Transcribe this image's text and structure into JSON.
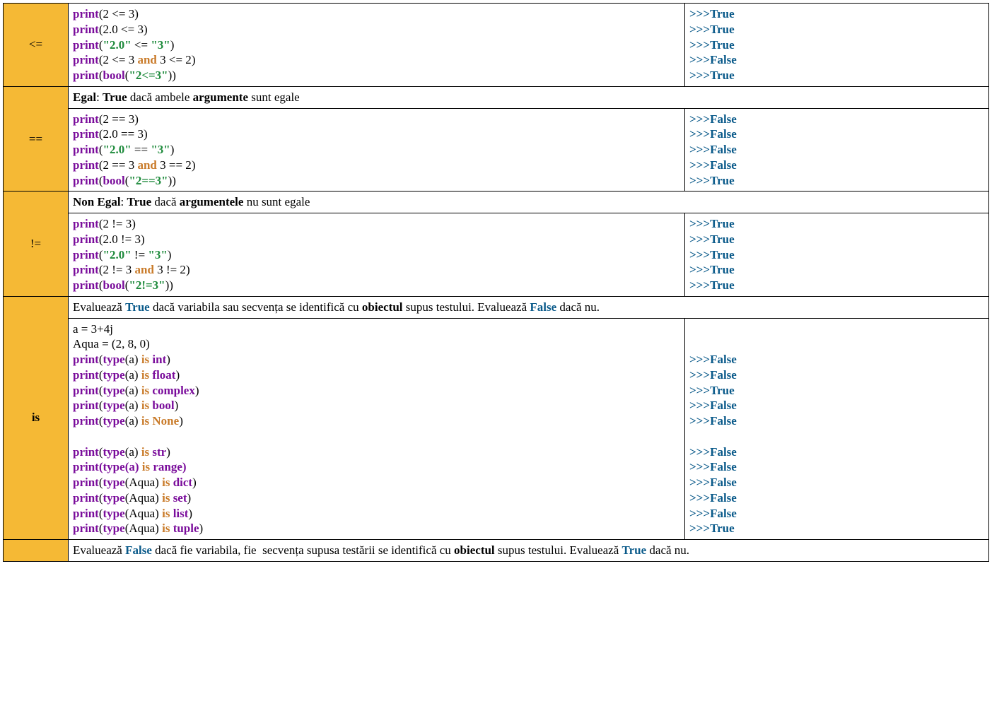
{
  "rows": [
    {
      "op": "<=",
      "opBold": false,
      "desc": null,
      "code": [
        [
          {
            "t": "print",
            "c": "kw"
          },
          {
            "t": "(",
            "c": "ptxt"
          },
          {
            "t": "2 <= 3",
            "c": "ptxt"
          },
          {
            "t": ")",
            "c": "ptxt"
          }
        ],
        [
          {
            "t": "print",
            "c": "kw"
          },
          {
            "t": "(",
            "c": "ptxt"
          },
          {
            "t": "2.0 <= 3",
            "c": "ptxt"
          },
          {
            "t": ")",
            "c": "ptxt"
          }
        ],
        [
          {
            "t": "print",
            "c": "kw"
          },
          {
            "t": "(",
            "c": "ptxt"
          },
          {
            "t": "\"2.0\"",
            "c": "str"
          },
          {
            "t": " <= ",
            "c": "ptxt"
          },
          {
            "t": "\"3\"",
            "c": "str"
          },
          {
            "t": ")",
            "c": "ptxt"
          }
        ],
        [
          {
            "t": "print",
            "c": "kw"
          },
          {
            "t": "(",
            "c": "ptxt"
          },
          {
            "t": "2 <= 3 ",
            "c": "ptxt"
          },
          {
            "t": "and",
            "c": "op2"
          },
          {
            "t": " 3 <= 2",
            "c": "ptxt"
          },
          {
            "t": ")",
            "c": "ptxt"
          }
        ],
        [
          {
            "t": "print",
            "c": "kw"
          },
          {
            "t": "(",
            "c": "ptxt"
          },
          {
            "t": "bool",
            "c": "kw"
          },
          {
            "t": "(",
            "c": "ptxt"
          },
          {
            "t": "\"2<=3\"",
            "c": "str"
          },
          {
            "t": "))",
            "c": "ptxt"
          }
        ]
      ],
      "output": [
        [
          {
            "t": ">>>",
            "c": "pr"
          },
          {
            "t": "True",
            "c": "tr"
          }
        ],
        [
          {
            "t": ">>>",
            "c": "pr"
          },
          {
            "t": "True",
            "c": "tr"
          }
        ],
        [
          {
            "t": ">>>",
            "c": "pr"
          },
          {
            "t": "True",
            "c": "tr"
          }
        ],
        [
          {
            "t": ">>>",
            "c": "pr"
          },
          {
            "t": "False",
            "c": "tr"
          }
        ],
        [
          {
            "t": ">>>",
            "c": "pr"
          },
          {
            "t": "True",
            "c": "tr"
          }
        ]
      ]
    },
    {
      "op": "==",
      "opBold": false,
      "desc": [
        {
          "t": "Egal",
          "c": "b"
        },
        {
          "t": ": ",
          "c": ""
        },
        {
          "t": "True",
          "c": "b"
        },
        {
          "t": " dacă ambele ",
          "c": ""
        },
        {
          "t": "argumente",
          "c": "b"
        },
        {
          "t": " sunt egale",
          "c": ""
        }
      ],
      "code": [
        [
          {
            "t": "print",
            "c": "kw"
          },
          {
            "t": "(",
            "c": "ptxt"
          },
          {
            "t": "2 == 3",
            "c": "ptxt"
          },
          {
            "t": ")",
            "c": "ptxt"
          }
        ],
        [
          {
            "t": "print",
            "c": "kw"
          },
          {
            "t": "(",
            "c": "ptxt"
          },
          {
            "t": "2.0 == 3",
            "c": "ptxt"
          },
          {
            "t": ")",
            "c": "ptxt"
          }
        ],
        [
          {
            "t": "print",
            "c": "kw"
          },
          {
            "t": "(",
            "c": "ptxt"
          },
          {
            "t": "\"2.0\"",
            "c": "str"
          },
          {
            "t": " == ",
            "c": "ptxt"
          },
          {
            "t": "\"3\"",
            "c": "str"
          },
          {
            "t": ")",
            "c": "ptxt"
          }
        ],
        [
          {
            "t": "print",
            "c": "kw"
          },
          {
            "t": "(",
            "c": "ptxt"
          },
          {
            "t": "2 == 3 ",
            "c": "ptxt"
          },
          {
            "t": "and",
            "c": "op2"
          },
          {
            "t": " 3 == 2",
            "c": "ptxt"
          },
          {
            "t": ")",
            "c": "ptxt"
          }
        ],
        [
          {
            "t": "print",
            "c": "kw"
          },
          {
            "t": "(",
            "c": "ptxt"
          },
          {
            "t": "bool",
            "c": "kw"
          },
          {
            "t": "(",
            "c": "ptxt"
          },
          {
            "t": "\"2==3\"",
            "c": "str"
          },
          {
            "t": "))",
            "c": "ptxt"
          }
        ]
      ],
      "output": [
        [
          {
            "t": ">>>",
            "c": "pr"
          },
          {
            "t": "False",
            "c": "tr"
          }
        ],
        [
          {
            "t": ">>>",
            "c": "pr"
          },
          {
            "t": "False",
            "c": "tr"
          }
        ],
        [
          {
            "t": ">>>",
            "c": "pr"
          },
          {
            "t": "False",
            "c": "tr"
          }
        ],
        [
          {
            "t": ">>>",
            "c": "pr"
          },
          {
            "t": "False",
            "c": "tr"
          }
        ],
        [
          {
            "t": ">>>",
            "c": "pr"
          },
          {
            "t": "True",
            "c": "tr"
          }
        ]
      ]
    },
    {
      "op": "!=",
      "opBold": false,
      "desc": [
        {
          "t": "Non Egal",
          "c": "b"
        },
        {
          "t": ": ",
          "c": ""
        },
        {
          "t": "True",
          "c": "b"
        },
        {
          "t": " dacă ",
          "c": ""
        },
        {
          "t": "argumentele",
          "c": "b"
        },
        {
          "t": " nu sunt egale",
          "c": ""
        }
      ],
      "code": [
        [
          {
            "t": "print",
            "c": "kw"
          },
          {
            "t": "(",
            "c": "ptxt"
          },
          {
            "t": "2 != 3",
            "c": "ptxt"
          },
          {
            "t": ")",
            "c": "ptxt"
          }
        ],
        [
          {
            "t": "print",
            "c": "kw"
          },
          {
            "t": "(",
            "c": "ptxt"
          },
          {
            "t": "2.0 != 3",
            "c": "ptxt"
          },
          {
            "t": ")",
            "c": "ptxt"
          }
        ],
        [
          {
            "t": "print",
            "c": "kw"
          },
          {
            "t": "(",
            "c": "ptxt"
          },
          {
            "t": "\"2.0\"",
            "c": "str"
          },
          {
            "t": " != ",
            "c": "ptxt"
          },
          {
            "t": "\"3\"",
            "c": "str"
          },
          {
            "t": ")",
            "c": "ptxt"
          }
        ],
        [
          {
            "t": "print",
            "c": "kw"
          },
          {
            "t": "(",
            "c": "ptxt"
          },
          {
            "t": "2 != 3 ",
            "c": "ptxt"
          },
          {
            "t": "and",
            "c": "op2"
          },
          {
            "t": " 3 != 2",
            "c": "ptxt"
          },
          {
            "t": ")",
            "c": "ptxt"
          }
        ],
        [
          {
            "t": "print",
            "c": "kw"
          },
          {
            "t": "(",
            "c": "ptxt"
          },
          {
            "t": "bool",
            "c": "kw"
          },
          {
            "t": "(",
            "c": "ptxt"
          },
          {
            "t": "\"2!=3\"",
            "c": "str"
          },
          {
            "t": "))",
            "c": "ptxt"
          }
        ]
      ],
      "output": [
        [
          {
            "t": ">>>",
            "c": "pr"
          },
          {
            "t": "True",
            "c": "tr"
          }
        ],
        [
          {
            "t": ">>>",
            "c": "pr"
          },
          {
            "t": "True",
            "c": "tr"
          }
        ],
        [
          {
            "t": ">>>",
            "c": "pr"
          },
          {
            "t": "True",
            "c": "tr"
          }
        ],
        [
          {
            "t": ">>>",
            "c": "pr"
          },
          {
            "t": "True",
            "c": "tr"
          }
        ],
        [
          {
            "t": ">>>",
            "c": "pr"
          },
          {
            "t": "True",
            "c": "tr"
          }
        ]
      ]
    },
    {
      "op": "is",
      "opBold": true,
      "desc": [
        {
          "t": "Evaluează ",
          "c": ""
        },
        {
          "t": "True",
          "c": "blue"
        },
        {
          "t": " dacă variabila sau secvența se identifică cu ",
          "c": ""
        },
        {
          "t": "obiectul",
          "c": "b"
        },
        {
          "t": " supus testului. Evaluează ",
          "c": ""
        },
        {
          "t": "False",
          "c": "blue"
        },
        {
          "t": " dacă nu.",
          "c": ""
        }
      ],
      "code": [
        [
          {
            "t": "a = 3+4j",
            "c": "ptxt"
          }
        ],
        [
          {
            "t": "Aqua = (2, 8, 0)",
            "c": "ptxt"
          }
        ],
        [
          {
            "t": "print",
            "c": "kw"
          },
          {
            "t": "(",
            "c": "ptxt"
          },
          {
            "t": "type",
            "c": "kw"
          },
          {
            "t": "(a) ",
            "c": "ptxt"
          },
          {
            "t": "is",
            "c": "op2"
          },
          {
            "t": " ",
            "c": "ptxt"
          },
          {
            "t": "int",
            "c": "typ"
          },
          {
            "t": ")",
            "c": "ptxt"
          }
        ],
        [
          {
            "t": "print",
            "c": "kw"
          },
          {
            "t": "(",
            "c": "ptxt"
          },
          {
            "t": "type",
            "c": "kw"
          },
          {
            "t": "(a) ",
            "c": "ptxt"
          },
          {
            "t": "is",
            "c": "op2"
          },
          {
            "t": " ",
            "c": "ptxt"
          },
          {
            "t": "float",
            "c": "typ"
          },
          {
            "t": ")",
            "c": "ptxt"
          }
        ],
        [
          {
            "t": "print",
            "c": "kw"
          },
          {
            "t": "(",
            "c": "ptxt"
          },
          {
            "t": "type",
            "c": "kw"
          },
          {
            "t": "(a) ",
            "c": "ptxt"
          },
          {
            "t": "is",
            "c": "op2"
          },
          {
            "t": " ",
            "c": "ptxt"
          },
          {
            "t": "complex",
            "c": "typ"
          },
          {
            "t": ")",
            "c": "ptxt"
          }
        ],
        [
          {
            "t": "print",
            "c": "kw"
          },
          {
            "t": "(",
            "c": "ptxt"
          },
          {
            "t": "type",
            "c": "kw"
          },
          {
            "t": "(a) ",
            "c": "ptxt"
          },
          {
            "t": "is",
            "c": "op2"
          },
          {
            "t": " ",
            "c": "ptxt"
          },
          {
            "t": "bool",
            "c": "typ"
          },
          {
            "t": ")",
            "c": "ptxt"
          }
        ],
        [
          {
            "t": "print",
            "c": "kw"
          },
          {
            "t": "(",
            "c": "ptxt"
          },
          {
            "t": "type",
            "c": "kw"
          },
          {
            "t": "(a) ",
            "c": "ptxt"
          },
          {
            "t": "is",
            "c": "op2"
          },
          {
            "t": " ",
            "c": "ptxt"
          },
          {
            "t": "None",
            "c": "op2"
          },
          {
            "t": ")",
            "c": "ptxt"
          }
        ],
        [
          {
            "t": " ",
            "c": "ptxt"
          }
        ],
        [
          {
            "t": "print",
            "c": "kw"
          },
          {
            "t": "(",
            "c": "ptxt"
          },
          {
            "t": "type",
            "c": "kw"
          },
          {
            "t": "(a) ",
            "c": "ptxt"
          },
          {
            "t": "is",
            "c": "op2"
          },
          {
            "t": " ",
            "c": "ptxt"
          },
          {
            "t": "str",
            "c": "typ"
          },
          {
            "t": ")",
            "c": "ptxt"
          }
        ],
        [
          {
            "t": "print",
            "c": "kw"
          },
          {
            "t": "(",
            "c": "kw"
          },
          {
            "t": "type",
            "c": "kw"
          },
          {
            "t": "(a) ",
            "c": "kw"
          },
          {
            "t": "is",
            "c": "op2"
          },
          {
            "t": " ",
            "c": "kw"
          },
          {
            "t": "range",
            "c": "typ"
          },
          {
            "t": ")",
            "c": "kw"
          }
        ],
        [
          {
            "t": "print",
            "c": "kw"
          },
          {
            "t": "(",
            "c": "ptxt"
          },
          {
            "t": "type",
            "c": "kw"
          },
          {
            "t": "(Aqua) ",
            "c": "ptxt"
          },
          {
            "t": "is",
            "c": "op2"
          },
          {
            "t": " ",
            "c": "ptxt"
          },
          {
            "t": "dict",
            "c": "typ"
          },
          {
            "t": ")",
            "c": "ptxt"
          }
        ],
        [
          {
            "t": "print",
            "c": "kw"
          },
          {
            "t": "(",
            "c": "ptxt"
          },
          {
            "t": "type",
            "c": "kw"
          },
          {
            "t": "(Aqua) ",
            "c": "ptxt"
          },
          {
            "t": "is",
            "c": "op2"
          },
          {
            "t": " ",
            "c": "ptxt"
          },
          {
            "t": "set",
            "c": "typ"
          },
          {
            "t": ")",
            "c": "ptxt"
          }
        ],
        [
          {
            "t": "print",
            "c": "kw"
          },
          {
            "t": "(",
            "c": "ptxt"
          },
          {
            "t": "type",
            "c": "kw"
          },
          {
            "t": "(Aqua) ",
            "c": "ptxt"
          },
          {
            "t": "is",
            "c": "op2"
          },
          {
            "t": " ",
            "c": "ptxt"
          },
          {
            "t": "list",
            "c": "typ"
          },
          {
            "t": ")",
            "c": "ptxt"
          }
        ],
        [
          {
            "t": "print",
            "c": "kw"
          },
          {
            "t": "(",
            "c": "ptxt"
          },
          {
            "t": "type",
            "c": "kw"
          },
          {
            "t": "(Aqua) ",
            "c": "ptxt"
          },
          {
            "t": "is",
            "c": "op2"
          },
          {
            "t": " ",
            "c": "ptxt"
          },
          {
            "t": "tuple",
            "c": "typ"
          },
          {
            "t": ")",
            "c": "ptxt"
          }
        ]
      ],
      "output": [
        [
          {
            "t": " ",
            "c": ""
          }
        ],
        [
          {
            "t": " ",
            "c": ""
          }
        ],
        [
          {
            "t": ">>>",
            "c": "pr"
          },
          {
            "t": "False",
            "c": "tr"
          }
        ],
        [
          {
            "t": ">>>",
            "c": "pr"
          },
          {
            "t": "False",
            "c": "tr"
          }
        ],
        [
          {
            "t": ">>>",
            "c": "pr"
          },
          {
            "t": "True",
            "c": "tr"
          }
        ],
        [
          {
            "t": ">>>",
            "c": "pr"
          },
          {
            "t": "False",
            "c": "tr"
          }
        ],
        [
          {
            "t": ">>>",
            "c": "pr"
          },
          {
            "t": "False",
            "c": "tr"
          }
        ],
        [
          {
            "t": " ",
            "c": ""
          }
        ],
        [
          {
            "t": ">>>",
            "c": "pr"
          },
          {
            "t": "False",
            "c": "tr"
          }
        ],
        [
          {
            "t": ">>>",
            "c": "pr"
          },
          {
            "t": "False",
            "c": "tr"
          }
        ],
        [
          {
            "t": ">>>",
            "c": "pr"
          },
          {
            "t": "False",
            "c": "tr"
          }
        ],
        [
          {
            "t": ">>>",
            "c": "pr"
          },
          {
            "t": "False",
            "c": "tr"
          }
        ],
        [
          {
            "t": ">>>",
            "c": "pr"
          },
          {
            "t": "False",
            "c": "tr"
          }
        ],
        [
          {
            "t": ">>>",
            "c": "pr"
          },
          {
            "t": "True",
            "c": "tr"
          }
        ]
      ]
    }
  ],
  "lastRow": {
    "op": "",
    "desc": [
      {
        "t": "Evaluează ",
        "c": ""
      },
      {
        "t": "False",
        "c": "blue"
      },
      {
        "t": " dacă fie variabila, fie  secvența supusa testării se identifică cu ",
        "c": ""
      },
      {
        "t": "obiectul",
        "c": "b"
      },
      {
        "t": " supus testului. Evaluează ",
        "c": ""
      },
      {
        "t": "True",
        "c": "blue"
      },
      {
        "t": " dacă nu.",
        "c": ""
      }
    ]
  }
}
